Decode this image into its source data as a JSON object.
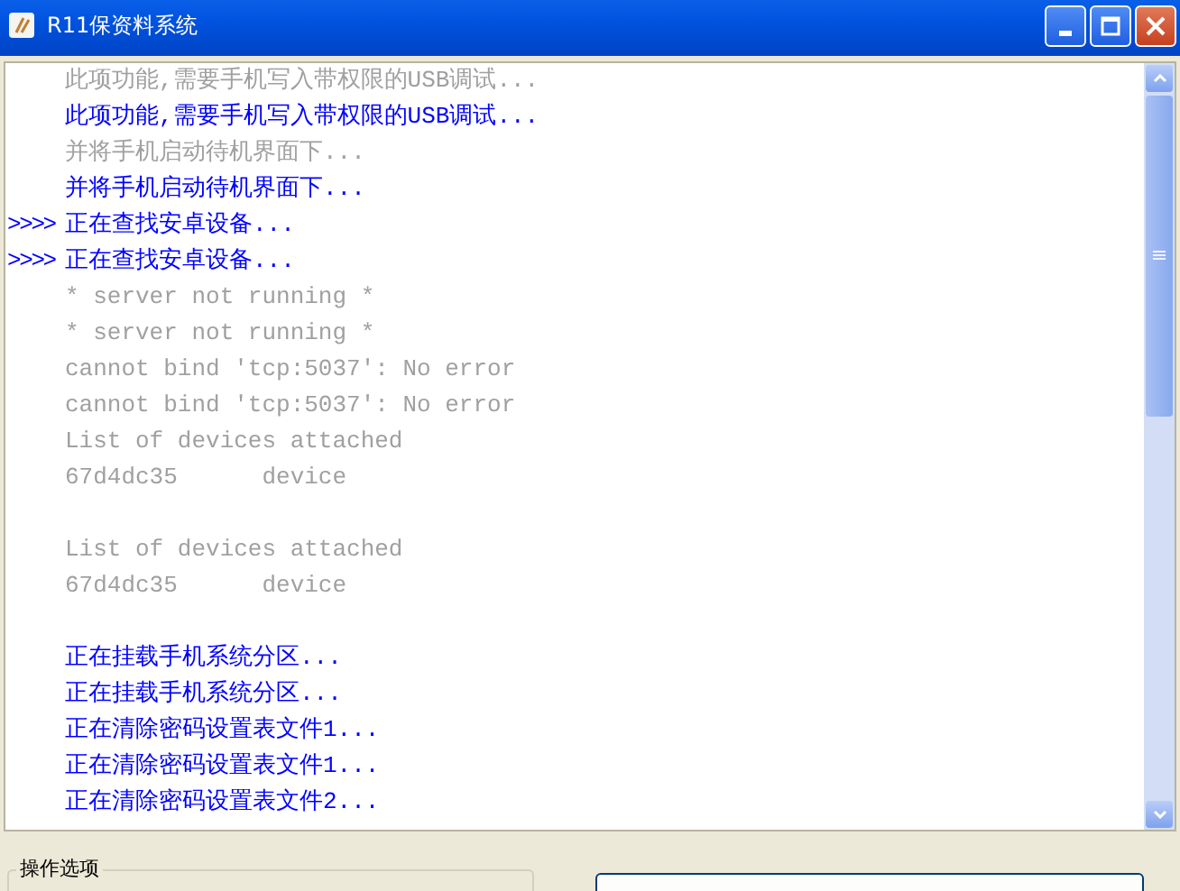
{
  "window": {
    "title": "R11保资料系统"
  },
  "log": [
    {
      "text": "此项功能,需要手机写入带权限的USB调试...",
      "color": "#a0a0a0"
    },
    {
      "text": "此项功能,需要手机写入带权限的USB调试...",
      "color": "#0000ff"
    },
    {
      "text": "并将手机启动待机界面下...",
      "color": "#a0a0a0"
    },
    {
      "text": "并将手机启动待机界面下...",
      "color": "#0000ff"
    },
    {
      "marker": ">>>>",
      "text": "正在查找安卓设备...",
      "color": "#0000ff"
    },
    {
      "marker": ">>>>",
      "text": "正在查找安卓设备...",
      "color": "#0000ff"
    },
    {
      "text": "* server not running *",
      "color": "#a0a0a0"
    },
    {
      "text": "* server not running *",
      "color": "#a0a0a0"
    },
    {
      "text": "cannot bind 'tcp:5037': No error",
      "color": "#a0a0a0"
    },
    {
      "text": "cannot bind 'tcp:5037': No error",
      "color": "#a0a0a0"
    },
    {
      "text": "List of devices attached",
      "color": "#a0a0a0"
    },
    {
      "text": "67d4dc35      device",
      "color": "#a0a0a0"
    },
    {
      "text": "List of devices attached",
      "color": "#a0a0a0",
      "gap_before": true
    },
    {
      "text": "67d4dc35      device",
      "color": "#a0a0a0"
    },
    {
      "text": "正在挂载手机系统分区...",
      "color": "#0000ff",
      "gap_before": true
    },
    {
      "text": "正在挂载手机系统分区...",
      "color": "#0000ff"
    },
    {
      "text": "正在清除密码设置表文件1...",
      "color": "#0000ff"
    },
    {
      "text": "正在清除密码设置表文件1...",
      "color": "#0000ff"
    },
    {
      "text": "正在清除密码设置表文件2...",
      "color": "#0000ff"
    }
  ],
  "options_group": {
    "title": "操作选项"
  }
}
